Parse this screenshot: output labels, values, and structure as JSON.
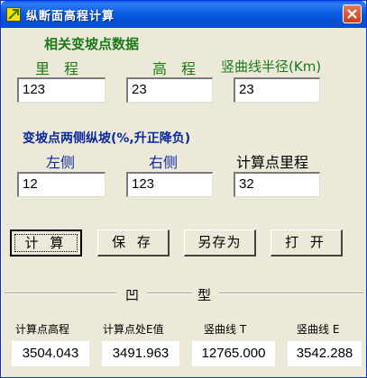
{
  "window": {
    "title": "纵断面高程计算"
  },
  "section1": {
    "title": "相关变坡点数据",
    "labels": {
      "mileage": "里　程",
      "elevation": "高　程",
      "radius": "竖曲线半径(Km)"
    },
    "values": {
      "mileage": "123",
      "elevation": "23",
      "radius": "23"
    }
  },
  "section2": {
    "title": "变坡点两侧纵坡(%,升正降负)",
    "labels": {
      "left": "左侧",
      "right": "右侧",
      "calc_mileage": "计算点里程"
    },
    "values": {
      "left": "12",
      "right": "123",
      "calc_mileage": "32"
    }
  },
  "buttons": {
    "calc": "计 算",
    "save": "保 存",
    "save_as": "另存为",
    "open": "打 开"
  },
  "result": {
    "type_left": "凹",
    "type_right": "型",
    "labels": {
      "elev": "计算点高程",
      "e_at": "计算点处E值",
      "t": "竖曲线 T",
      "e": "竖曲线 E"
    },
    "values": {
      "elev": "3504.043",
      "e_at": "3491.963",
      "t": "12765.000",
      "e": "3542.288"
    }
  }
}
